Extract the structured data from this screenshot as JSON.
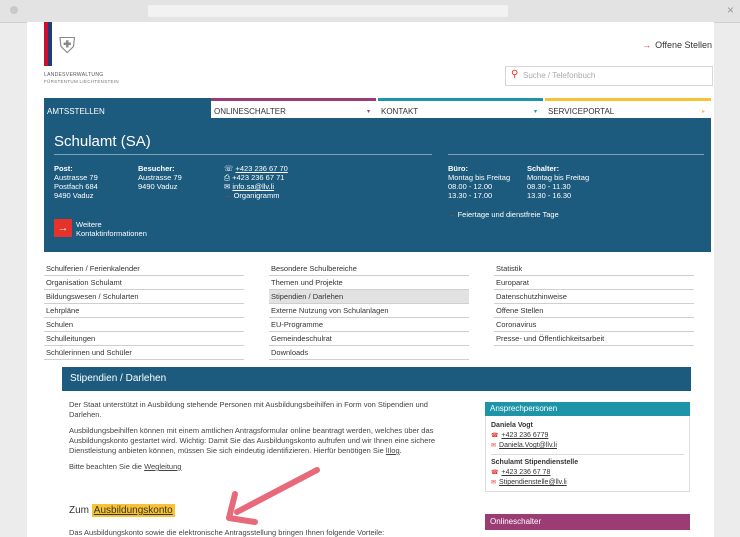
{
  "browser": {
    "close": "×"
  },
  "header": {
    "org_line1": "LANDESVERWALTUNG",
    "org_line2": "FÜRSTENTUM LIECHTENSTEIN",
    "top_link": "Offene Stellen",
    "search_placeholder": "Suche / Telefonbuch"
  },
  "nav": [
    {
      "label": "AMTSSTELLEN",
      "color": "#1d5b7e",
      "caret": ""
    },
    {
      "label": "ONLINESCHALTER",
      "color": "#9c3c75",
      "caret": "▾"
    },
    {
      "label": "KONTAKT",
      "color": "#1e94a8",
      "caret": "▾"
    },
    {
      "label": "SERVICEPORTAL",
      "color": "#f7c233",
      "caret": "▸"
    }
  ],
  "office": {
    "title": "Schulamt (SA)",
    "post_label": "Post:",
    "post_lines": [
      "Austrasse 79",
      "Postfach 684",
      "9490 Vaduz"
    ],
    "visitor_label": "Besucher:",
    "visitor_lines": [
      "Austrasse 79",
      "9490 Vaduz"
    ],
    "phone": "+423 236 67 70",
    "fax": "+423 236 67 71",
    "email": "info.sa@llv.li",
    "organigram": "Organigramm",
    "buero_label": "Büro:",
    "buero_lines": [
      "Montag bis Freitag",
      "08.00 - 12.00",
      "13.30 - 17.00"
    ],
    "schalter_label": "Schalter:",
    "schalter_lines": [
      "Montag bis Freitag",
      "08.30 - 11.30",
      "13.30 - 16.30"
    ],
    "holidays": "Feiertage und dienstfreie Tage",
    "more_line1": "Weitere",
    "more_line2": "Kontaktinformationen"
  },
  "links": {
    "col1": [
      "Schulferien / Ferienkalender",
      "Organisation Schulamt",
      "Bildungswesen / Schularten",
      "Lehrpläne",
      "Schulen",
      "Schulleitungen",
      "Schülerinnen und Schüler"
    ],
    "col2": [
      "Besondere Schulbereiche",
      "Themen und Projekte",
      "Stipendien / Darlehen",
      "Externe Nutzung von Schulanlagen",
      "EU-Programme",
      "Gemeindeschulrat",
      "Downloads"
    ],
    "col3": [
      "Statistik",
      "Europarat",
      "Datenschutzhinweise",
      "Offene Stellen",
      "Coronavirus",
      "Presse- und Öffentlichkeitsarbeit"
    ]
  },
  "content": {
    "section_title": "Stipendien / Darlehen",
    "p1": "Der Staat unterstützt in Ausbildung stehende Personen mit Ausbildungsbeihilfen in Form von Stipendien und Darlehen.",
    "p2": "Ausbildungsbeihilfen können mit einem amtlichen Antragsformular online beantragt werden, welches über das Ausbildungskonto gestartet wird. Wichtig: Damit Sie das Ausbildungskonto aufrufen und wir Ihnen eine sichere Dienstleistung anbieten können, müssen Sie sich eindeutig identifizieren. Hierfür benötigen Sie",
    "p2_link": "lIlog",
    "p3_pre": "Bitte beachten Sie die",
    "p3_link": "Wegleitung",
    "zum_pre": "Zum",
    "zum_link": "Ausbildungskonto",
    "last": "Das Ausbildungskonto sowie die elektronische Antragsstellung bringen Ihnen folgende Vorteile:"
  },
  "sidebar": {
    "contacts_title": "Ansprechpersonen",
    "person1": "Daniela Vogt",
    "person1_phone": "+423 236 6779",
    "person1_email": "Daniela.Vogt@llv.li",
    "person2": "Schulamt Stipendienstelle",
    "person2_phone": "+423 236 67 78",
    "person2_email": "Stipendienstelle@llv.li",
    "online_title": "Onlineschalter"
  }
}
